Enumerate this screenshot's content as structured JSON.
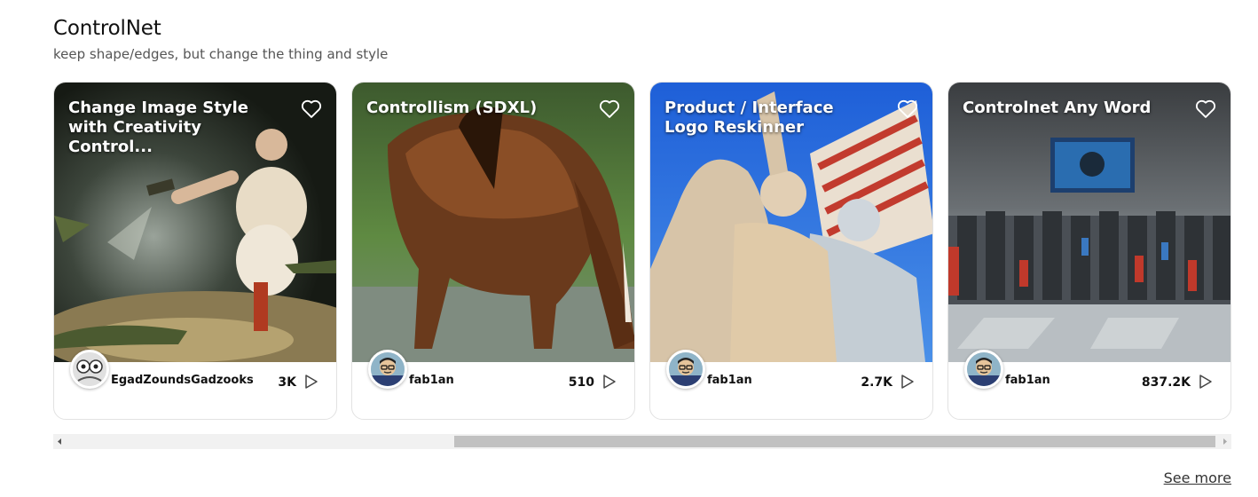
{
  "section": {
    "title": "ControlNet",
    "subtitle": "keep shape/edges, but change the thing and style",
    "see_more_label": "See more"
  },
  "cards": [
    {
      "title": "Change Image Style with Creativity Control...",
      "author": "EgadZoundsGadzooks",
      "count": "3K"
    },
    {
      "title": "Controllism (SDXL)",
      "author": "fab1an",
      "count": "510"
    },
    {
      "title": "Product / Interface Logo Reskinner",
      "author": "fab1an",
      "count": "2.7K"
    },
    {
      "title": "Controlnet Any Word",
      "author": "fab1an",
      "count": "837.2K"
    }
  ],
  "icons": {
    "favorite": "heart-outline-icon",
    "run": "play-outline-icon"
  },
  "scrollbar": {
    "position_fraction": 0.34,
    "visible_fraction": 0.65
  }
}
